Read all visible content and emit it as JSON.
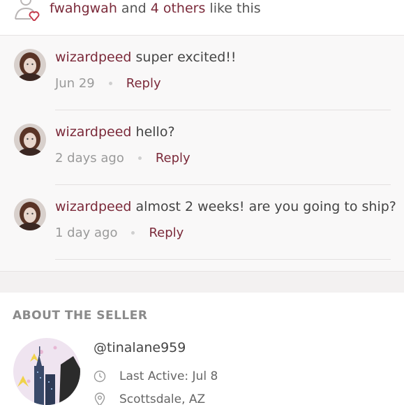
{
  "likes": {
    "first_user": "fwahgwah",
    "and_text": "and",
    "others_text": "4 others",
    "suffix_text": "like this"
  },
  "comments": [
    {
      "user": "wizardpeed",
      "text": "super excited!!",
      "time": "Jun 29",
      "reply_label": "Reply"
    },
    {
      "user": "wizardpeed",
      "text": "hello?",
      "time": "2 days ago",
      "reply_label": "Reply"
    },
    {
      "user": "wizardpeed",
      "text": "almost 2 weeks! are you going to ship?",
      "time": "1 day ago",
      "reply_label": "Reply"
    }
  ],
  "about": {
    "heading": "ABOUT THE SELLER",
    "handle": "@tinalane959",
    "last_active": "Last Active: Jul 8",
    "location": "Scottsdale, AZ"
  },
  "colors": {
    "accent": "#7b2a3a",
    "muted": "#9a9a9a",
    "comments_bg": "#f9f8f8"
  },
  "icons": {
    "likes": "heart-user-icon",
    "last_active": "clock-icon",
    "location": "location-pin-icon"
  }
}
